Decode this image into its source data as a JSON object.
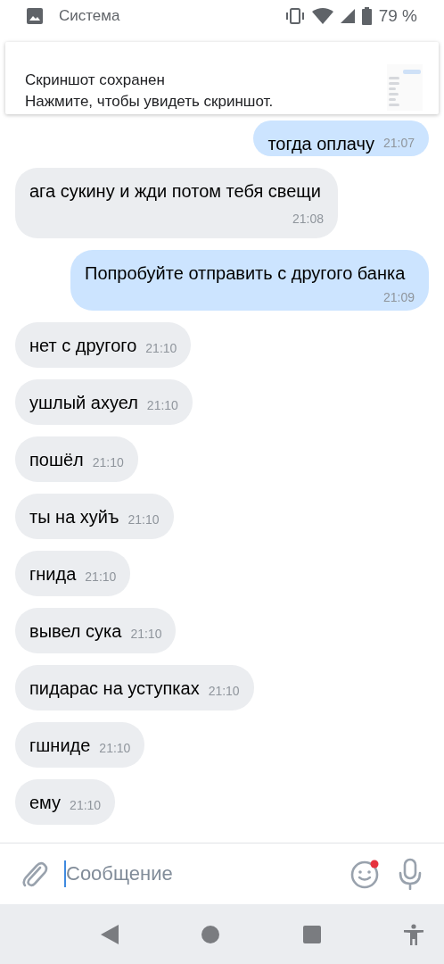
{
  "status_bar": {
    "app": "Система",
    "battery": "79 %"
  },
  "notification": {
    "title": "Скриншот сохранен",
    "text": "Нажмите, чтобы увидеть скриншот."
  },
  "messages": [
    {
      "text": "тогда оплачу",
      "time": "21:07",
      "outgoing": true
    },
    {
      "text": "ага сукину и жди потом тебя свещи",
      "time": "21:08",
      "outgoing": false
    },
    {
      "text": "Попробуйте отправить с другого банка",
      "time": "21:09",
      "outgoing": true
    },
    {
      "text": "нет с другого",
      "time": "21:10",
      "outgoing": false
    },
    {
      "text": "ушлый ахуел",
      "time": "21:10",
      "outgoing": false
    },
    {
      "text": "пошёл",
      "time": "21:10",
      "outgoing": false
    },
    {
      "text": "ты на хуйъ",
      "time": "21:10",
      "outgoing": false
    },
    {
      "text": "гнида",
      "time": "21:10",
      "outgoing": false
    },
    {
      "text": "вывел сука",
      "time": "21:10",
      "outgoing": false
    },
    {
      "text": "пидарас на уступках",
      "time": "21:10",
      "outgoing": false
    },
    {
      "text": "гшниде",
      "time": "21:10",
      "outgoing": false
    },
    {
      "text": "ему",
      "time": "21:10",
      "outgoing": false
    }
  ],
  "composer": {
    "placeholder": "Сообщение"
  }
}
